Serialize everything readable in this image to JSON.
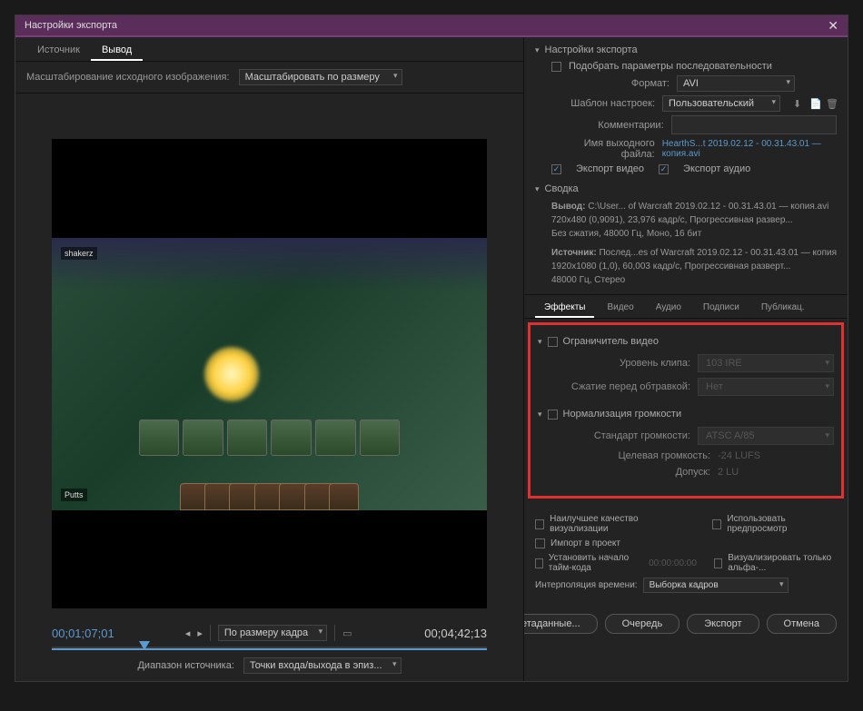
{
  "titlebar": {
    "title": "Настройки экспорта"
  },
  "leftTabs": {
    "source": "Источник",
    "output": "Вывод"
  },
  "scaleRow": {
    "label": "Масштабирование исходного изображения:",
    "value": "Масштабировать по размеру"
  },
  "preview": {
    "player1": "shakerz",
    "player2": "Putts"
  },
  "timeline": {
    "current": "00;01;07;01",
    "total": "00;04;42;13",
    "fitLabel": "По размеру кадра",
    "rangeLabel": "Диапазон источника:",
    "rangeValue": "Точки входа/выхода в эпиз..."
  },
  "export": {
    "header": "Настройки экспорта",
    "matchSeq": "Подобрать параметры последовательности",
    "formatLabel": "Формат:",
    "formatValue": "AVI",
    "presetLabel": "Шаблон настроек:",
    "presetValue": "Пользовательский",
    "commentsLabel": "Комментарии:",
    "outputNameLabel": "Имя выходного файла:",
    "outputNameValue": "HearthS...t 2019.02.12 - 00.31.43.01 — копия.avi",
    "exportVideo": "Экспорт видео",
    "exportAudio": "Экспорт аудио"
  },
  "summary": {
    "header": "Сводка",
    "outputLabel": "Вывод:",
    "outputText": "C:\\User... of Warcraft 2019.02.12 - 00.31.43.01 — копия.avi\n720x480 (0,9091), 23,976 кадр/с, Прогрессивная развер...\nБез сжатия, 48000 Гц, Моно, 16 бит",
    "sourceLabel": "Источник:",
    "sourceText": "Послед...es of Warcraft 2019.02.12 - 00.31.43.01 — копия\n1920x1080 (1,0), 60,003 кадр/с, Прогрессивная разверт...\n48000 Гц, Стерео"
  },
  "tabs2": {
    "effects": "Эффекты",
    "video": "Видео",
    "audio": "Аудио",
    "captions": "Подписи",
    "publish": "Публикац."
  },
  "effects": {
    "limiter": {
      "title": "Ограничитель видео",
      "clipLevel": "Уровень клипа:",
      "clipValue": "103 IRE",
      "compress": "Сжатие перед обтравкой:",
      "compressValue": "Нет"
    },
    "normalize": {
      "title": "Нормализация громкости",
      "standard": "Стандарт громкости:",
      "standardValue": "ATSC A/85",
      "target": "Целевая громкость:",
      "targetValue": "-24 LUFS",
      "tolerance": "Допуск:",
      "toleranceValue": "2 LU"
    }
  },
  "options": {
    "maxQuality": "Наилучшее качество визуализации",
    "usePreview": "Использовать предпросмотр",
    "importProject": "Импорт в проект",
    "setTimecode": "Установить начало тайм-кода",
    "timecodeValue": "00:00:00:00",
    "renderAlpha": "Визуализировать только альфа-...",
    "interpLabel": "Интерполяция времени:",
    "interpValue": "Выборка кадров"
  },
  "buttons": {
    "metadata": "Метаданные...",
    "queue": "Очередь",
    "export": "Экспорт",
    "cancel": "Отмена"
  }
}
